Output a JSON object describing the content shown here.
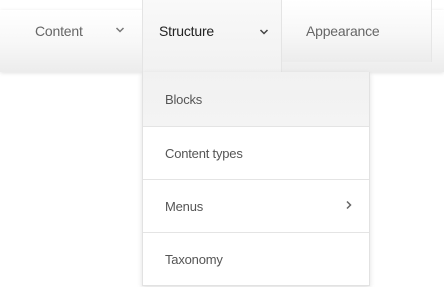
{
  "nav": {
    "items": [
      {
        "label": "Content",
        "icon": "chevron-down-icon"
      },
      {
        "label": "Structure",
        "icon": "chevron-down-icon",
        "active": true
      },
      {
        "label": "Appearance"
      }
    ]
  },
  "dropdown": {
    "items": [
      {
        "label": "Blocks"
      },
      {
        "label": "Content types"
      },
      {
        "label": "Menus",
        "icon": "chevron-right-icon"
      },
      {
        "label": "Taxonomy"
      }
    ]
  },
  "colors": {
    "text": "#666666",
    "active_text": "#222222",
    "border": "#e4e4e4"
  }
}
